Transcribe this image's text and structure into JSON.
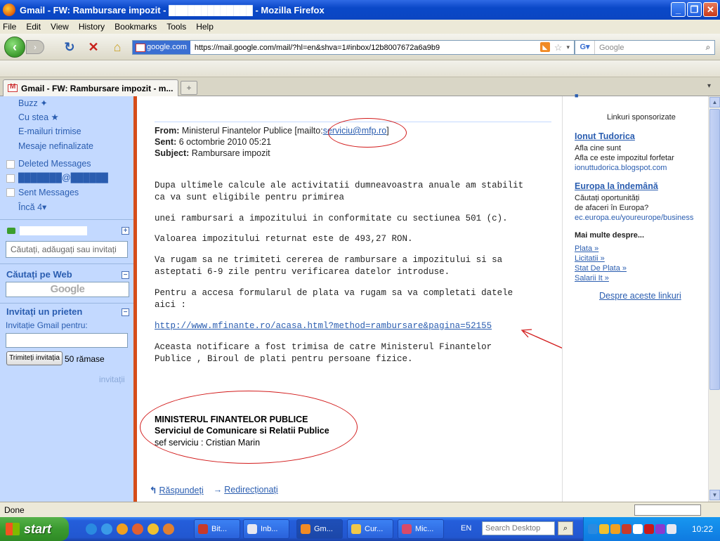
{
  "window": {
    "title": "Gmail - FW: Rambursare impozit - █████████████ - Mozilla Firefox",
    "controls": [
      "_",
      "❐",
      "✕"
    ]
  },
  "menu": [
    "File",
    "Edit",
    "View",
    "History",
    "Bookmarks",
    "Tools",
    "Help"
  ],
  "nav": {
    "site_label": "google.com",
    "url": "https://mail.google.com/mail/?hl=en&shva=1#inbox/12b8007672a6a9b9",
    "search_placeholder": "Google"
  },
  "tabs": [
    {
      "label": "Gmail - FW: Rambursare impozit - m..."
    }
  ],
  "sidebar": {
    "links": [
      {
        "label": "Buzz ✦"
      },
      {
        "label": "Cu stea ★"
      },
      {
        "label": "E-mailuri trimise"
      },
      {
        "label": "Mesaje nefinalizate"
      }
    ],
    "labels": [
      {
        "label": "Deleted Messages"
      },
      {
        "label": "███████@██████"
      },
      {
        "label": "Sent Messages"
      }
    ],
    "more": "Încă 4▾",
    "chat_search_placeholder": "Căutați, adăugați sau invitați",
    "web_search_heading": "Căutați pe Web",
    "google_logo": "Google",
    "invite_heading": "Invitați un prieten",
    "invite_label": "Invitație Gmail pentru:",
    "invite_button": "Trimiteți invitația",
    "invites_remaining": "50 rămase",
    "invites_link": "invitații",
    "collapse_symbol": "−",
    "add_symbol": "+"
  },
  "message": {
    "from_label": "From:",
    "from_value": "Ministerul Finantelor Publice [mailto:",
    "from_email": "serviciu@mfp.ro",
    "from_close": "]",
    "sent_label": "Sent:",
    "sent_value": "6 octombrie 2010 05:21",
    "subject_label": "Subject:",
    "subject_value": "Rambursare impozit",
    "body": [
      "Dupa ultimele calcule ale activitatii dumneavoastra anuale am stabilit\nca va sunt eligibile pentru primirea",
      "unei rambursari a impozitului in conformitate cu sectiunea 501 (c).",
      "Valoarea impozitului returnat este de 493,27 RON.",
      "Va rugam sa ne trimiteti cererea de rambursare a impozitului si sa\nasteptati 6-9 zile pentru verificarea datelor introduse.",
      "Pentru a accesa formularul de plata va rugam sa va completati datele\naici :"
    ],
    "link": "http://www.mfinante.ro/acasa.html?method=rambursare&pagina=52155",
    "footer_note": "Aceasta notificare a fost trimisa de catre Ministerul Finantelor\nPublice , Biroul de plati pentru persoane fizice.",
    "signature": {
      "org": "MINISTERUL FINANTELOR PUBLICE",
      "dept": "Serviciul de Comunicare si Relatii Publice",
      "person": "sef serviciu : Cristian Marin"
    },
    "reply": "Răspundeți",
    "forward": "Redirecționați"
  },
  "ads": {
    "heading": "Linkuri sponsorizate",
    "items": [
      {
        "title": "Ionut Tudorica",
        "lines": [
          "Afla cine sunt",
          "Afla ce este impozitul forfetar"
        ],
        "url": "ionuttudorica.blogspot.com"
      },
      {
        "title": "Europa la îndemână",
        "lines": [
          "Căutați oportunități",
          "de afaceri în Europa?"
        ],
        "url": "ec.europa.eu/youreurope/business"
      }
    ],
    "more_heading": "Mai multe despre...",
    "more_links": [
      "Plata »",
      "Licitatii »",
      "Stat De Plata »",
      "Salarii It »"
    ],
    "about_link": "Despre aceste linkuri"
  },
  "status": {
    "text": "Done"
  },
  "taskbar": {
    "start": "start",
    "tasks": [
      {
        "label": "Bit...",
        "icon_color": "#c83a2a"
      },
      {
        "label": "Inb...",
        "icon_color": "#e8e8f0"
      },
      {
        "label": "Gm...",
        "icon_color": "#f08a24"
      },
      {
        "label": "Cur...",
        "icon_color": "#f0c84a"
      },
      {
        "label": "Mic...",
        "icon_color": "#d84a6a"
      }
    ],
    "language": "EN",
    "search_placeholder": "Search Desktop",
    "clock": "10:22"
  },
  "colors": {
    "gmail_blue": "#c3d9ff",
    "link_blue": "#2a5db0",
    "annotation_red": "#d21a1a",
    "sidebar_edge": "#d54d1a"
  }
}
